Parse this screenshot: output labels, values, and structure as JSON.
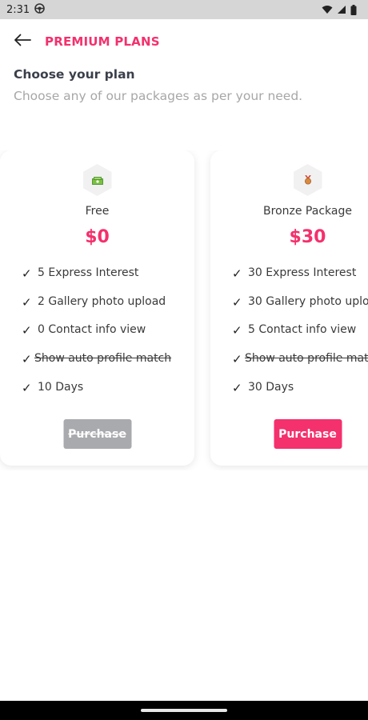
{
  "status_bar": {
    "time": "2:31"
  },
  "header": {
    "title": "PREMIUM PLANS"
  },
  "intro": {
    "title": "Choose your plan",
    "subtitle": "Choose any of our packages as per your need."
  },
  "plans": [
    {
      "name": "Free",
      "price": "$0",
      "icon": "money-icon",
      "features": [
        {
          "label": "5 Express Interest",
          "available": true
        },
        {
          "label": "2 Gallery photo upload",
          "available": true
        },
        {
          "label": "0 Contact info view",
          "available": true
        },
        {
          "label": "Show auto profile match",
          "available": false
        },
        {
          "label": "10 Days",
          "available": true
        }
      ],
      "button": {
        "label": "Purchase",
        "enabled": false
      }
    },
    {
      "name": "Bronze Package",
      "price": "$30",
      "icon": "bronze-medal-icon",
      "features": [
        {
          "label": "30 Express Interest",
          "available": true
        },
        {
          "label": "30 Gallery photo uplo",
          "available": true
        },
        {
          "label": "5 Contact info view",
          "available": true
        },
        {
          "label": "Show auto profile mat",
          "available": false
        },
        {
          "label": "30 Days",
          "available": true
        }
      ],
      "button": {
        "label": "Purchase",
        "enabled": true
      }
    }
  ],
  "check_glyph": "✓",
  "colors": {
    "accent": "#f4306d",
    "disabled": "#a9aaad",
    "muted_text": "#a7a7a7"
  }
}
